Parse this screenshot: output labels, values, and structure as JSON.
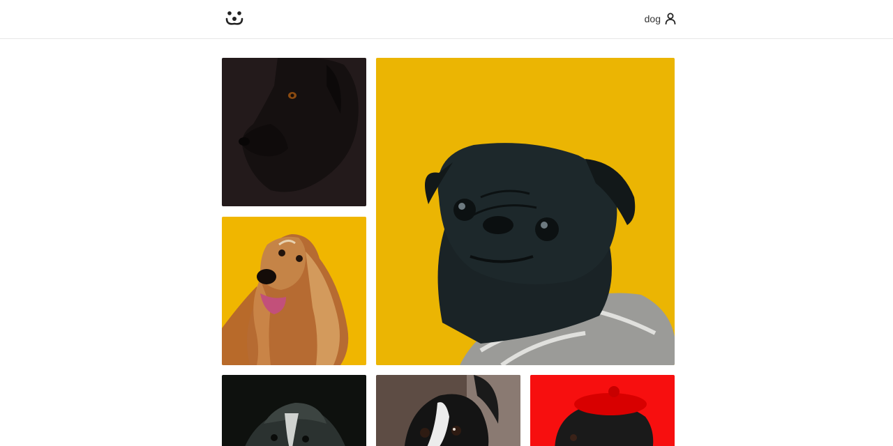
{
  "header": {
    "logo_icon": "dog-face-logo-icon",
    "username": "dog",
    "user_icon": "user-icon"
  },
  "gallery": {
    "photos": [
      {
        "subject": "black-dog-portrait",
        "background": "#231a1a"
      },
      {
        "subject": "black-pug-in-sweater",
        "background": "#ebb503"
      },
      {
        "subject": "afghan-hound",
        "background": "#f0b600"
      },
      {
        "subject": "black-white-collie",
        "background": "#101310"
      },
      {
        "subject": "boston-terrier",
        "background": "#5a4b44"
      },
      {
        "subject": "pug-in-red-beret",
        "background": "#f70f0f"
      }
    ]
  },
  "colors": {
    "header_border": "#e6e6e6",
    "text": "#333333"
  }
}
